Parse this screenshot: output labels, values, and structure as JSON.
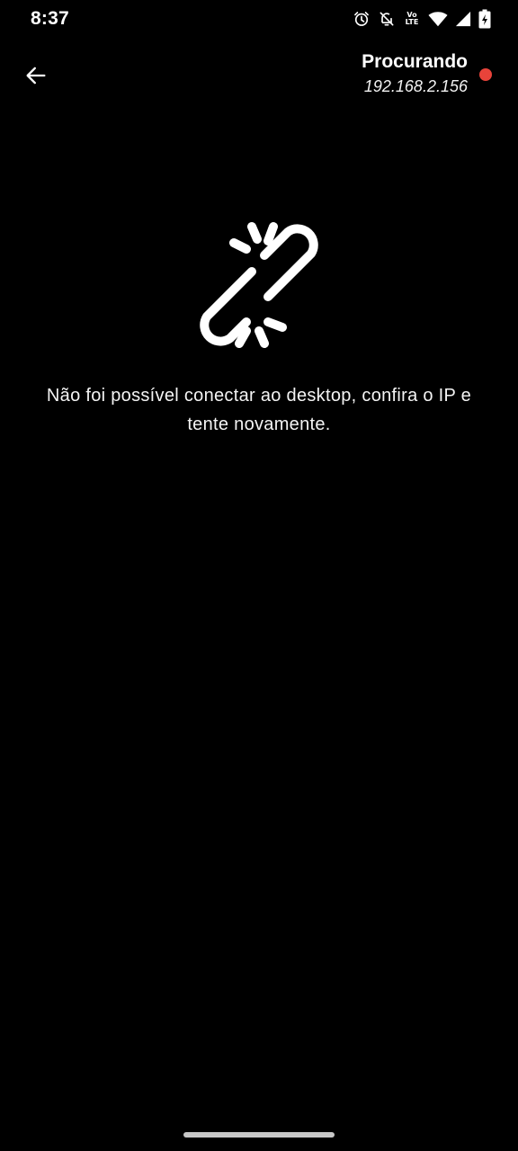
{
  "status_bar": {
    "time": "8:37",
    "icons": [
      "alarm-icon",
      "notifications-off-icon",
      "volte-lte-icon",
      "wifi-icon",
      "signal-icon",
      "battery-charging-icon"
    ],
    "lte_top": "Vo",
    "lte_bottom": "LTE"
  },
  "app_bar": {
    "back_icon": "arrow-back-icon",
    "status_title": "Procurando",
    "ip_address": "192.168.2.156",
    "status_color": "#e8433a"
  },
  "main": {
    "icon": "broken-link-icon",
    "message": "Não foi possível conectar ao desktop, confira o IP e tente novamente."
  },
  "colors": {
    "background": "#000000",
    "text": "#ffffff",
    "status_dot": "#e8433a"
  }
}
